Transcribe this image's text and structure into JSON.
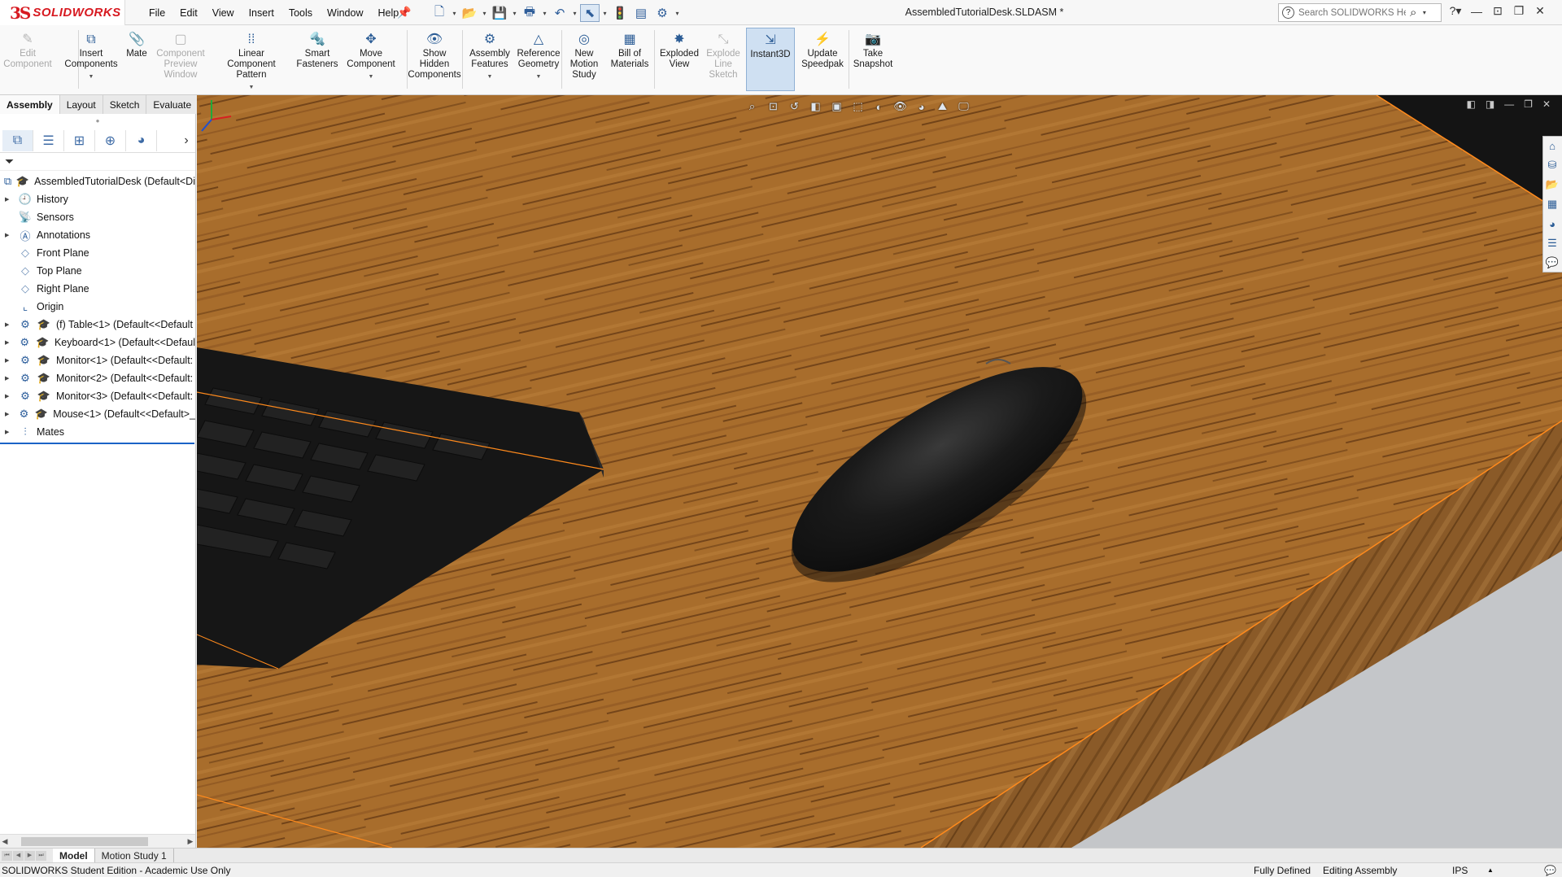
{
  "app": {
    "brand_prefix": "3S",
    "brand_name": "SOLIDWORKS",
    "document_title": "AssembledTutorialDesk.SLDASM *"
  },
  "menus": [
    "File",
    "Edit",
    "View",
    "Insert",
    "Tools",
    "Window",
    "Help"
  ],
  "help_search": {
    "placeholder": "Search SOLIDWORKS Help"
  },
  "toolbar": [
    {
      "id": "edit-component",
      "lines": [
        "Edit",
        "Component"
      ],
      "icon": "edit-component-icon",
      "enabled": false
    },
    {
      "id": "insert-components",
      "lines": [
        "Insert",
        "Components"
      ],
      "icon": "insert-components-icon",
      "enabled": true,
      "dropdown": true
    },
    {
      "id": "mate",
      "lines": [
        "Mate"
      ],
      "icon": "mate-icon",
      "enabled": true
    },
    {
      "id": "component-preview-window",
      "lines": [
        "Component",
        "Preview",
        "Window"
      ],
      "icon": "preview-window-icon",
      "enabled": false
    },
    {
      "id": "linear-component-pattern",
      "lines": [
        "Linear Component",
        "Pattern"
      ],
      "icon": "linear-pattern-icon",
      "enabled": true,
      "dropdown": true
    },
    {
      "id": "smart-fasteners",
      "lines": [
        "Smart",
        "Fasteners"
      ],
      "icon": "smart-fasteners-icon",
      "enabled": true
    },
    {
      "id": "move-component",
      "lines": [
        "Move",
        "Component"
      ],
      "icon": "move-component-icon",
      "enabled": true,
      "dropdown": true
    },
    {
      "id": "show-hidden-components",
      "lines": [
        "Show",
        "Hidden",
        "Components"
      ],
      "icon": "show-hidden-icon",
      "enabled": true
    },
    {
      "id": "assembly-features",
      "lines": [
        "Assembly",
        "Features"
      ],
      "icon": "assembly-features-icon",
      "enabled": true,
      "dropdown": true
    },
    {
      "id": "reference-geometry",
      "lines": [
        "Reference",
        "Geometry"
      ],
      "icon": "reference-geometry-icon",
      "enabled": true,
      "dropdown": true
    },
    {
      "id": "new-motion-study",
      "lines": [
        "New",
        "Motion",
        "Study"
      ],
      "icon": "motion-study-icon",
      "enabled": true
    },
    {
      "id": "bill-of-materials",
      "lines": [
        "Bill of",
        "Materials"
      ],
      "icon": "bom-icon",
      "enabled": true
    },
    {
      "id": "exploded-view",
      "lines": [
        "Exploded",
        "View"
      ],
      "icon": "exploded-view-icon",
      "enabled": true
    },
    {
      "id": "explode-line-sketch",
      "lines": [
        "Explode",
        "Line",
        "Sketch"
      ],
      "icon": "explode-line-icon",
      "enabled": false
    },
    {
      "id": "instant3d",
      "lines": [
        "Instant3D"
      ],
      "icon": "instant3d-icon",
      "enabled": true,
      "pressed": true
    },
    {
      "id": "update-speedpak",
      "lines": [
        "Update",
        "Speedpak"
      ],
      "icon": "speedpak-icon",
      "enabled": true
    },
    {
      "id": "take-snapshot",
      "lines": [
        "Take",
        "Snapshot"
      ],
      "icon": "camera-icon",
      "enabled": true
    }
  ],
  "command_tabs": [
    {
      "label": "Assembly",
      "active": true
    },
    {
      "label": "Layout",
      "active": false
    },
    {
      "label": "Sketch",
      "active": false
    },
    {
      "label": "Evaluate",
      "active": false
    }
  ],
  "tree": {
    "root": "AssembledTutorialDesk  (Default<Di",
    "items": [
      {
        "label": "History",
        "expandable": true,
        "icon": "history-icon"
      },
      {
        "label": "Sensors",
        "expandable": false,
        "icon": "sensors-icon"
      },
      {
        "label": "Annotations",
        "expandable": true,
        "icon": "annotations-icon"
      },
      {
        "label": "Front Plane",
        "expandable": false,
        "icon": "plane-icon"
      },
      {
        "label": "Top Plane",
        "expandable": false,
        "icon": "plane-icon"
      },
      {
        "label": "Right Plane",
        "expandable": false,
        "icon": "plane-icon"
      },
      {
        "label": "Origin",
        "expandable": false,
        "icon": "origin-icon"
      },
      {
        "label": "(f) Table<1> (Default<<Default",
        "expandable": true,
        "icon": "part-icon",
        "component": true
      },
      {
        "label": "Keyboard<1> (Default<<Defaul",
        "expandable": true,
        "icon": "part-icon",
        "component": true
      },
      {
        "label": "Monitor<1> (Default<<Default:",
        "expandable": true,
        "icon": "part-icon",
        "component": true
      },
      {
        "label": "Monitor<2> (Default<<Default:",
        "expandable": true,
        "icon": "part-icon",
        "component": true
      },
      {
        "label": "Monitor<3> (Default<<Default:",
        "expandable": true,
        "icon": "part-icon",
        "component": true
      },
      {
        "label": "Mouse<1> (Default<<Default>_",
        "expandable": true,
        "icon": "part-icon",
        "component": true
      },
      {
        "label": "Mates",
        "expandable": true,
        "icon": "mates-icon"
      }
    ]
  },
  "bottom_tabs": [
    {
      "label": "Model",
      "active": true
    },
    {
      "label": "Motion Study 1",
      "active": false
    }
  ],
  "status": {
    "edition": "SOLIDWORKS Student Edition - Academic Use Only",
    "definition": "Fully Defined",
    "mode": "Editing Assembly",
    "units": "IPS"
  },
  "colors": {
    "brand_red": "#d71920",
    "wood": "#a56a2a",
    "selection_edge": "#ff8a1c",
    "accent_blue": "#1b63c6"
  }
}
